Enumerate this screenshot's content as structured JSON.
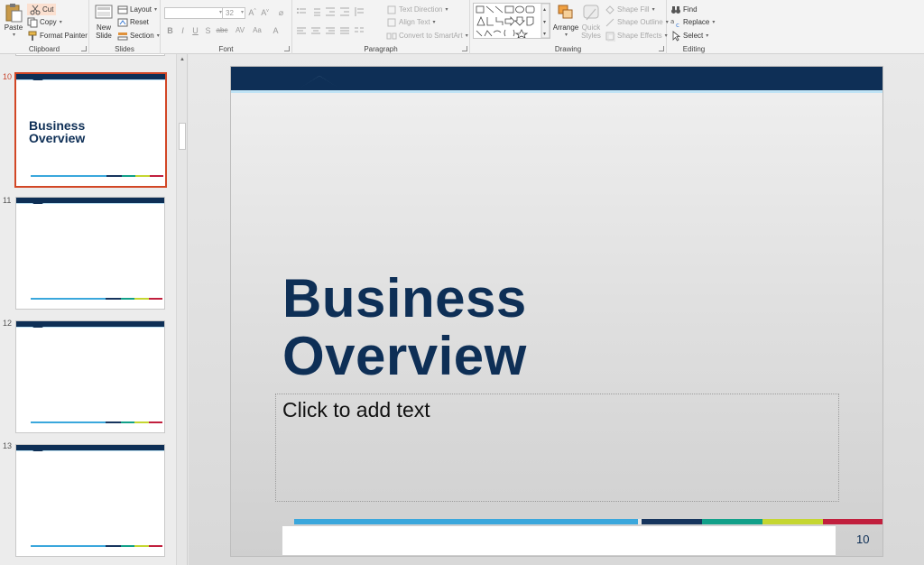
{
  "ribbon": {
    "clipboard": {
      "label": "Clipboard",
      "paste": "Paste",
      "cut": "Cut",
      "copy": "Copy",
      "format_painter": "Format Painter"
    },
    "slides": {
      "label": "Slides",
      "new_slide_line1": "New",
      "new_slide_line2": "Slide",
      "layout": "Layout",
      "reset": "Reset",
      "section": "Section"
    },
    "font": {
      "label": "Font",
      "font_size": "32",
      "bold": "B",
      "italic": "I",
      "underline": "U",
      "shadow": "S",
      "strike": "abc",
      "spacing": "AV",
      "case": "Aa",
      "color": "A"
    },
    "paragraph": {
      "label": "Paragraph",
      "text_direction": "Text Direction",
      "align_text": "Align Text",
      "convert_smartart": "Convert to SmartArt"
    },
    "drawing": {
      "label": "Drawing",
      "arrange": "Arrange",
      "quick_styles_line1": "Quick",
      "quick_styles_line2": "Styles",
      "shape_fill": "Shape Fill",
      "shape_outline": "Shape Outline",
      "shape_effects": "Shape Effects"
    },
    "editing": {
      "label": "Editing",
      "find": "Find",
      "replace": "Replace",
      "select": "Select"
    }
  },
  "thumbnails": [
    {
      "number": "10",
      "title_line1": "Business",
      "title_line2": "Overview",
      "selected": true
    },
    {
      "number": "11",
      "title_line1": "",
      "title_line2": "",
      "selected": false
    },
    {
      "number": "12",
      "title_line1": "",
      "title_line2": "",
      "selected": false
    },
    {
      "number": "13",
      "title_line1": "",
      "title_line2": "",
      "selected": false
    }
  ],
  "slide": {
    "title_line1": "Business",
    "title_line2": "Overview",
    "placeholder": "Click to add text",
    "slide_number": "10"
  },
  "colors": {
    "navy": "#0e2f56",
    "light_blue": "#bfe3f5",
    "stripe_blue": "#3aa7dc",
    "stripe_navy": "#16355e",
    "stripe_teal": "#12a089",
    "stripe_lime": "#c5d631",
    "stripe_red": "#c11f3d",
    "selection": "#d24726"
  }
}
